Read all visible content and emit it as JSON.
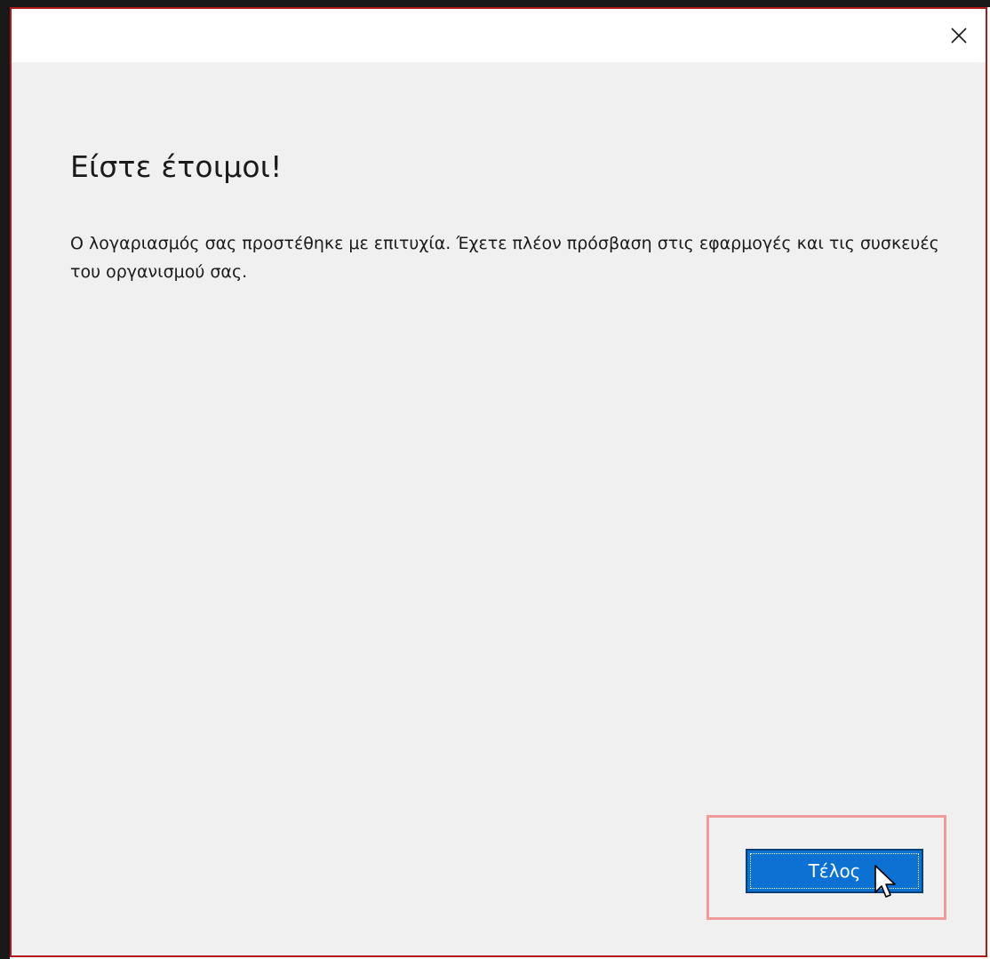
{
  "dialog": {
    "close_icon": "close-icon",
    "heading": "Είστε έτοιμοι!",
    "message": "Ο λογαριασμός σας προστέθηκε με επιτυχία. Έχετε πλέον πρόσβαση στις εφαρμογές και τις συσκευές του οργανισμού σας.",
    "finish_label": "Τέλος",
    "accent_color": "#0b72d4",
    "highlight_color": "#f09a9a",
    "border_color": "#b11818"
  },
  "cursor": {
    "icon": "mouse-pointer-icon"
  }
}
